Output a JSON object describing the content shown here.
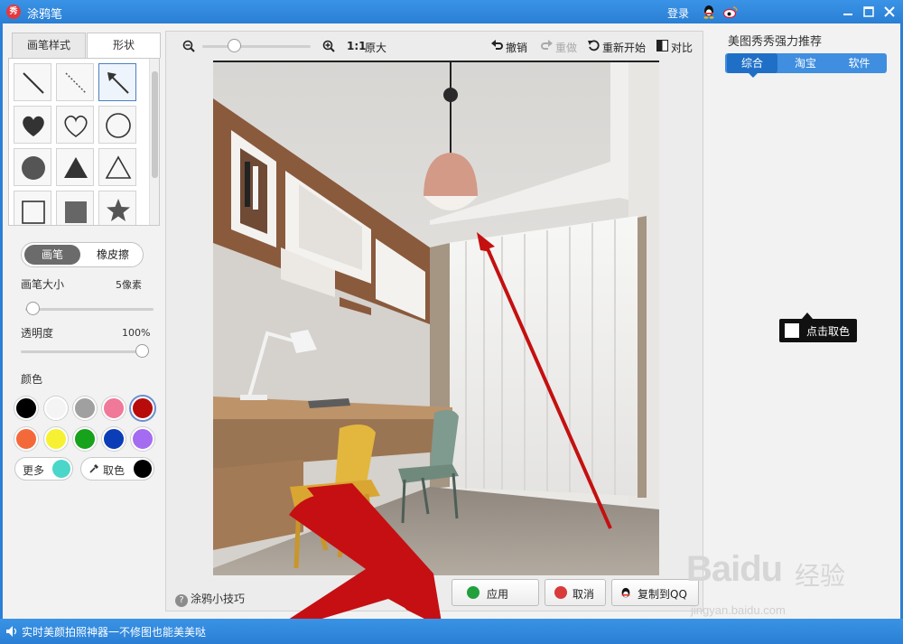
{
  "window": {
    "logo_text": "秀",
    "title": "涂鸦笔",
    "login": "登录"
  },
  "left": {
    "tabs": [
      "画笔样式",
      "形状"
    ],
    "active_tab": "形状",
    "shapes": [
      "line",
      "dashed-line",
      "arrow",
      "filled-heart",
      "outline-heart",
      "outline-circle",
      "filled-circle",
      "filled-triangle",
      "outline-triangle",
      "outline-square",
      "filled-square",
      "filled-star"
    ],
    "selected_shape": "arrow",
    "mode": {
      "brush": "画笔",
      "eraser": "橡皮擦",
      "active": "画笔"
    },
    "brush_size": {
      "label": "画笔大小",
      "value": "5像素"
    },
    "opacity": {
      "label": "透明度",
      "value": "100%"
    },
    "color_label": "颜色",
    "colors": [
      "#000000",
      "#f4f4f4",
      "#a0a0a0",
      "#f07898",
      "#b80c0c",
      "#f4693a",
      "#f6f233",
      "#16a21a",
      "#0b3db6",
      "#a46cf0"
    ],
    "selected_color": "#b80c0c",
    "more": {
      "label": "更多",
      "color": "#4ad6c8"
    },
    "picker": {
      "label": "取色",
      "color": "#000000"
    }
  },
  "toolbar": {
    "zoom_label": "1:1",
    "original_label": "原大",
    "undo": "撤销",
    "redo": "重做",
    "restart": "重新开始",
    "compare": "对比"
  },
  "bottom": {
    "help": "涂鸦小技巧",
    "apply": "应用",
    "cancel": "取消",
    "copy_qq": "复制到QQ"
  },
  "right": {
    "title": "美图秀秀强力推荐",
    "tabs": [
      "综合",
      "淘宝",
      "软件"
    ],
    "active_tab": "综合",
    "tooltip": "点击取色"
  },
  "watermark": {
    "logo": "Baidu",
    "cn": "经验",
    "url": "jingyan.baidu.com"
  },
  "status": {
    "text": "实时美颜拍照神器一不修图也能美美哒"
  },
  "accent_color": "#2a7fd4"
}
